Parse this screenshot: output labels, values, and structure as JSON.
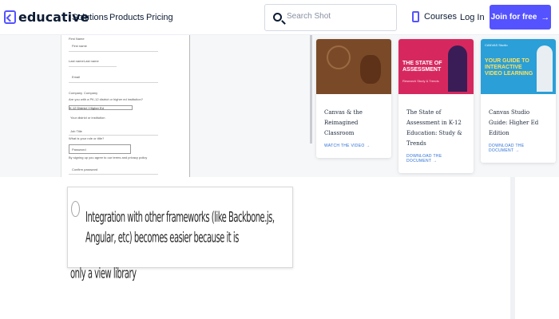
{
  "brand": {
    "name": "educative",
    "accent": "#5553ff"
  },
  "nav": {
    "links": [
      "Solutions",
      "Products",
      "Pricing"
    ]
  },
  "search": {
    "placeholder": "Search Shot"
  },
  "header_actions": {
    "courses": "Courses",
    "login": "Log In",
    "join": "Join for free",
    "join_icon": "arrow-right-icon"
  },
  "doc_form": {
    "fields": [
      "First Name",
      "First name",
      "Last name",
      "Last name",
      "Email",
      "Company",
      "Company",
      "Are you with a PK-12 district or higher ed institution?",
      "Your district or institution",
      "Job Title",
      "What is your role or title?",
      "Password",
      "Confirm password"
    ],
    "select_value": "K-12 District / Higher Ed",
    "notice": "By signing up you agree to our terms and privacy policy"
  },
  "cards": [
    {
      "image_text": "",
      "title": "Canvas & the Reimagined Classroom",
      "link": "WATCH THE VIDEO →"
    },
    {
      "image_text": "THE STATE OF ASSESSMENT",
      "image_sub": "Research Study & Trends",
      "title": "The State of Assessment in K-12 Education: Study & Trends",
      "link": "DOWNLOAD THE DOCUMENT →"
    },
    {
      "image_brand": "CANVAS Studio",
      "image_text": "YOUR GUIDE TO INTERACTIVE VIDEO LEARNING",
      "title": "Canvas Studio Guide: Higher Ed Edition",
      "link": "DOWNLOAD THE DOCUMENT →"
    }
  ],
  "quiz": {
    "option_text": "Integration with other frameworks (like Backbone.js, Angular, etc) becomes easier because it is",
    "option_text_cont": "only a view library"
  }
}
